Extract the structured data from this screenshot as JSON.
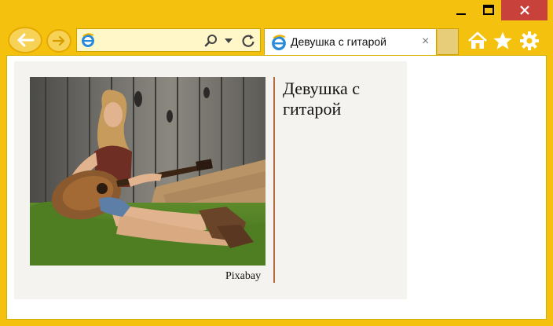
{
  "browser": {
    "address": {
      "value": "",
      "placeholder": ""
    },
    "tab": {
      "title": "Девушка с гитарой",
      "close_glyph": "×"
    },
    "colors": {
      "frame": "#f4c10f",
      "close_button": "#c9413b",
      "tab_bg": "#ffffff"
    },
    "icons": [
      "back-arrow-icon",
      "forward-arrow-icon",
      "ie-logo-icon",
      "search-icon",
      "dropdown-icon",
      "refresh-icon",
      "home-icon",
      "favorites-star-icon",
      "settings-gear-icon",
      "minimize-icon",
      "maximize-icon",
      "close-icon"
    ]
  },
  "page": {
    "figure": {
      "heading": "Девушка с гитарой",
      "caption": "Pixabay",
      "divider_color": "#b46a3e",
      "background": "#f4f3ef"
    }
  }
}
